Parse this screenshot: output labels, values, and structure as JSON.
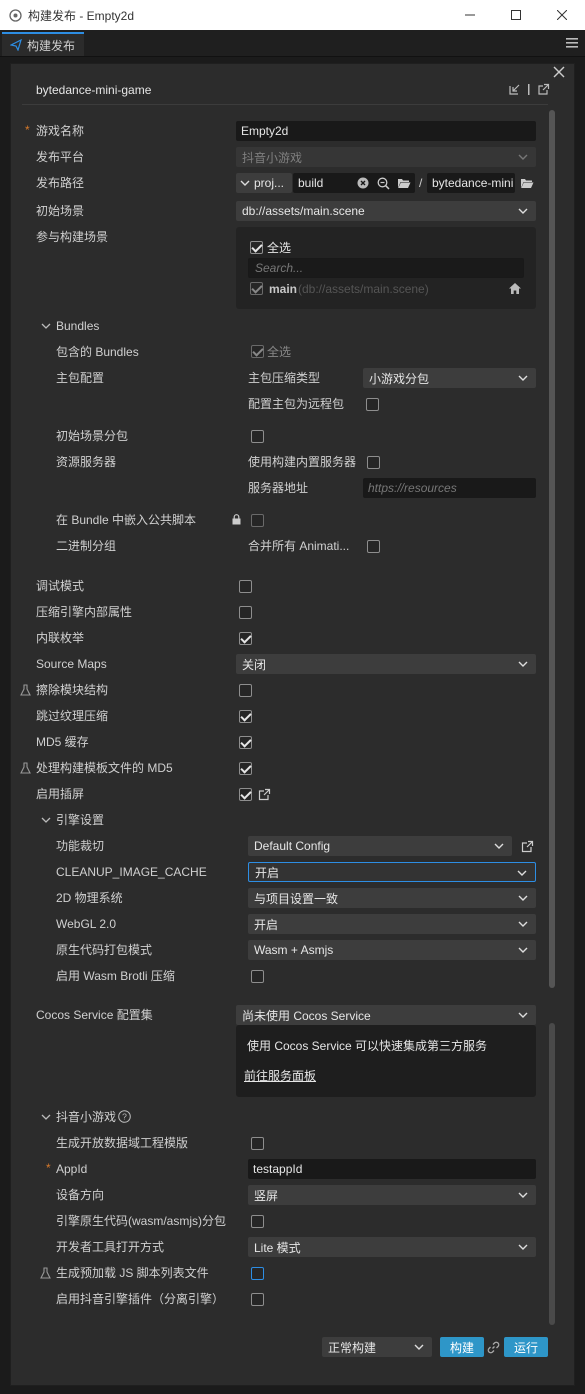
{
  "window": {
    "title": "构建发布 - Empty2d"
  },
  "tab": {
    "label": "构建发布"
  },
  "platform": {
    "name": "bytedance-mini-game"
  },
  "basic": {
    "game_name_label": "游戏名称",
    "game_name_value": "Empty2d",
    "platform_label": "发布平台",
    "platform_value": "抖音小游戏",
    "path_label": "发布路径",
    "path_proj": "proj...",
    "path_build": "build",
    "path_slash": "/",
    "path_output": "bytedance-mini",
    "start_scene_label": "初始场景",
    "start_scene_value": "db://assets/main.scene",
    "scenes_label": "参与构建场景",
    "select_all": "全选",
    "search_placeholder": "Search...",
    "scene_name": "main",
    "scene_path": "(db://assets/main.scene)"
  },
  "bundles": {
    "title": "Bundles",
    "include_label": "包含的 Bundles",
    "include_all": "全选",
    "main_config_label": "主包配置",
    "compress_type_label": "主包压缩类型",
    "compress_type_value": "小游戏分包",
    "remote_label": "配置主包为远程包",
    "start_scene_sub_label": "初始场景分包",
    "res_server_label": "资源服务器",
    "builtin_server_label": "使用构建内置服务器",
    "server_addr_label": "服务器地址",
    "server_addr_placeholder": "https://resources",
    "embed_label": "在 Bundle 中嵌入公共脚本",
    "binary_label": "二进制分组",
    "merge_anim_label": "合并所有 Animati..."
  },
  "options": {
    "debug": "调试模式",
    "compress_props": "压缩引擎内部属性",
    "inline_enum": "内联枚举",
    "source_maps": "Source Maps",
    "source_maps_value": "关闭",
    "erase_modules": "擦除模块结构",
    "skip_tex_compress": "跳过纹理压缩",
    "md5_cache": "MD5 缓存",
    "md5_template": "处理构建模板文件的 MD5",
    "splash": "启用插屏"
  },
  "engine": {
    "title": "引擎设置",
    "cull_label": "功能裁切",
    "cull_value": "Default Config",
    "cleanup_label": "CLEANUP_IMAGE_CACHE",
    "cleanup_value": "开启",
    "physics_label": "2D 物理系统",
    "physics_value": "与项目设置一致",
    "webgl_label": "WebGL 2.0",
    "webgl_value": "开启",
    "native_label": "原生代码打包模式",
    "native_value": "Wasm + Asmjs",
    "brotli_label": "启用 Wasm Brotli 压缩"
  },
  "cocos": {
    "label": "Cocos Service 配置集",
    "value": "尚未使用 Cocos Service",
    "desc": "使用 Cocos Service 可以快速集成第三方服务",
    "link": "前往服务面板"
  },
  "douyin": {
    "title": "抖音小游戏",
    "open_data_label": "生成开放数据域工程模版",
    "appid_label": "AppId",
    "appid_value": "testappId",
    "orientation_label": "设备方向",
    "orientation_value": "竖屏",
    "subpkg_label": "引擎原生代码(wasm/asmjs)分包",
    "devtools_label": "开发者工具打开方式",
    "devtools_value": "Lite 模式",
    "preload_label": "生成预加载 JS 脚本列表文件",
    "plugin_label": "启用抖音引擎插件（分离引擎）"
  },
  "footer": {
    "mode_value": "正常构建",
    "build": "构建",
    "run": "运行"
  },
  "colors": {
    "accent": "#2d8ee4",
    "button": "#2e96c8",
    "required": "#d77a2b"
  }
}
